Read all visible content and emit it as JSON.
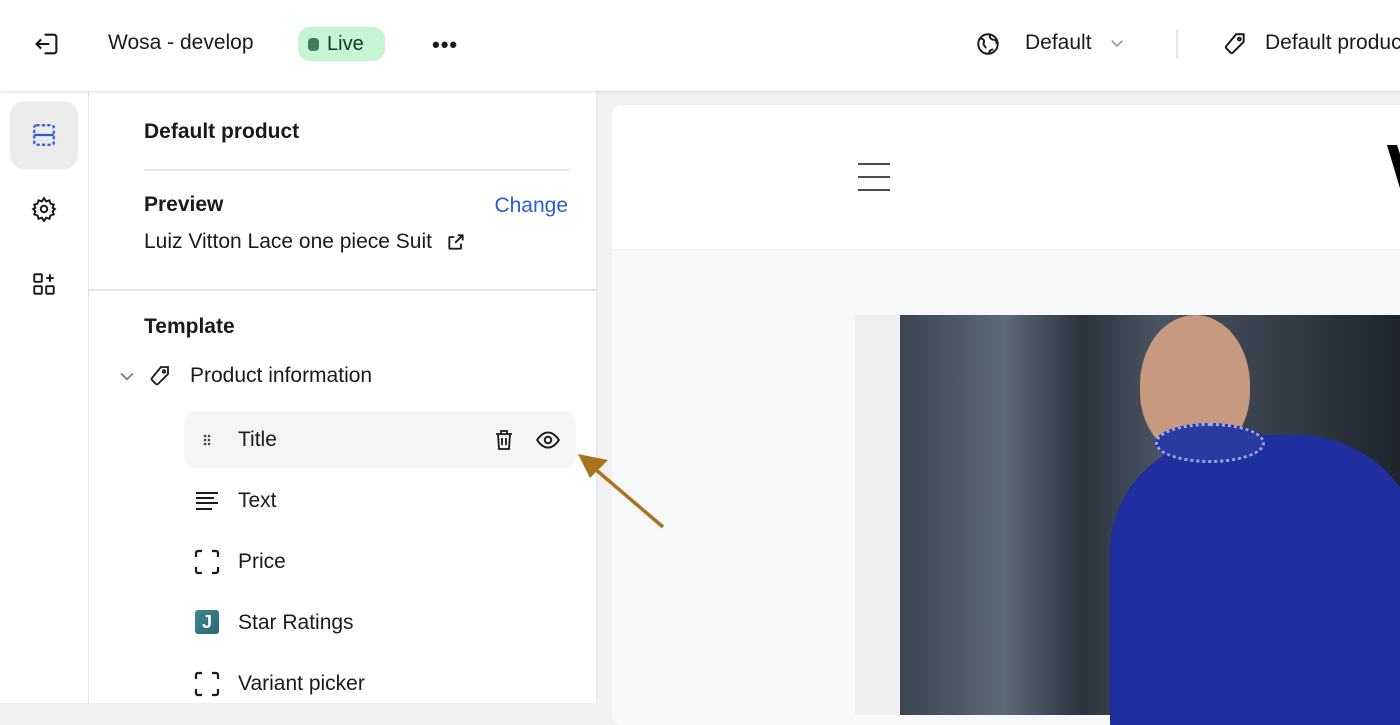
{
  "topbar": {
    "store_name": "Wosa - develop",
    "status": "Live",
    "theme_selector": "Default",
    "template_selector": "Default product"
  },
  "sidebar": {
    "title": "Default product",
    "preview_label": "Preview",
    "change_link": "Change",
    "preview_product": "Luiz Vitton Lace one piece Suit",
    "template_label": "Template",
    "section": {
      "label": "Product information",
      "blocks": [
        {
          "label": "Title",
          "icon": "drag-handle-icon"
        },
        {
          "label": "Text",
          "icon": "text-lines-icon"
        },
        {
          "label": "Price",
          "icon": "dashed-block-icon"
        },
        {
          "label": "Star Ratings",
          "icon": "app-j-icon"
        },
        {
          "label": "Variant picker",
          "icon": "dashed-block-icon"
        }
      ]
    }
  },
  "colors": {
    "accent": "#2a5bd7",
    "live_bg": "#c5f5d3",
    "annotation_arrow": "#a8741e"
  }
}
